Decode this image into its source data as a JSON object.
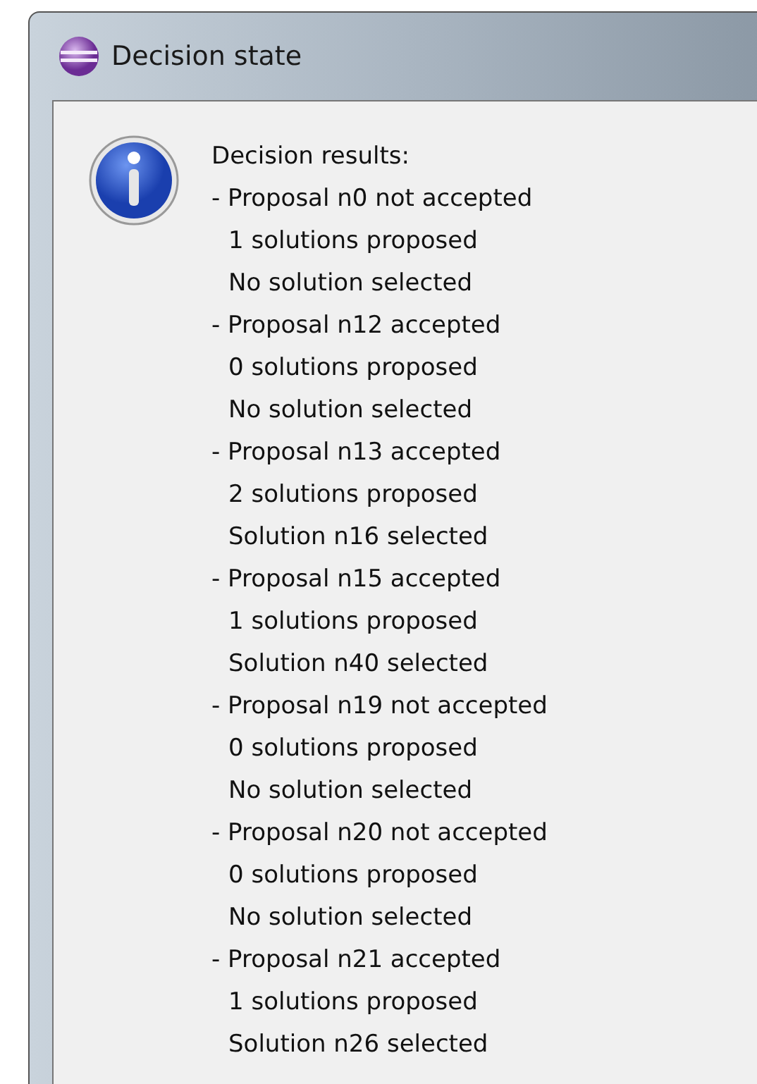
{
  "window": {
    "title": "Decision state"
  },
  "message": {
    "heading": "Decision results:",
    "proposals": [
      {
        "line": "- Proposal n0 not accepted",
        "solutions": "1 solutions proposed",
        "selection": "No solution selected"
      },
      {
        "line": "- Proposal n12 accepted",
        "solutions": "0 solutions proposed",
        "selection": "No solution selected"
      },
      {
        "line": "- Proposal n13 accepted",
        "solutions": "2 solutions proposed",
        "selection": "Solution n16 selected"
      },
      {
        "line": "- Proposal n15 accepted",
        "solutions": "1 solutions proposed",
        "selection": "Solution n40 selected"
      },
      {
        "line": "- Proposal n19 not accepted",
        "solutions": "0 solutions proposed",
        "selection": "No solution selected"
      },
      {
        "line": "- Proposal n20 not accepted",
        "solutions": "0 solutions proposed",
        "selection": "No solution selected"
      },
      {
        "line": "- Proposal n21 accepted",
        "solutions": "1 solutions proposed",
        "selection": "Solution n26 selected"
      }
    ]
  }
}
